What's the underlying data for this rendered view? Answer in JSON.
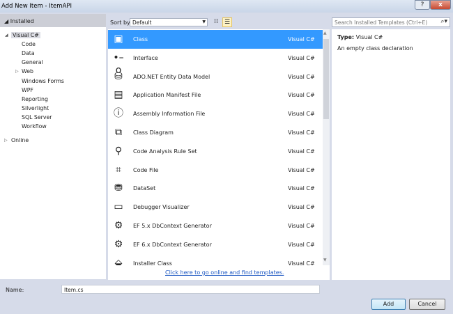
{
  "window": {
    "title": "Add New Item - ItemAPI",
    "help": "?",
    "close": "x"
  },
  "tree": {
    "header": "Installed",
    "items": [
      {
        "label": "Visual C#"
      },
      {
        "label": "Code"
      },
      {
        "label": "Data"
      },
      {
        "label": "General"
      },
      {
        "label": "Web"
      },
      {
        "label": "Windows Forms"
      },
      {
        "label": "WPF"
      },
      {
        "label": "Reporting"
      },
      {
        "label": "Silverlight"
      },
      {
        "label": "SQL Server"
      },
      {
        "label": "Workflow"
      }
    ],
    "online": "Online"
  },
  "toolbar": {
    "sort_label": "Sort by:",
    "sort_value": "Default"
  },
  "search": {
    "placeholder": "Search Installed Templates (Ctrl+E)"
  },
  "templates": [
    {
      "name": "Class",
      "lang": "Visual C#",
      "icon": "class-icon"
    },
    {
      "name": "Interface",
      "lang": "Visual C#",
      "icon": "interface-icon"
    },
    {
      "name": "ADO.NET Entity Data Model",
      "lang": "Visual C#",
      "icon": "entity-model-icon"
    },
    {
      "name": "Application Manifest File",
      "lang": "Visual C#",
      "icon": "manifest-icon"
    },
    {
      "name": "Assembly Information File",
      "lang": "Visual C#",
      "icon": "assembly-info-icon"
    },
    {
      "name": "Class Diagram",
      "lang": "Visual C#",
      "icon": "class-diagram-icon"
    },
    {
      "name": "Code Analysis Rule Set",
      "lang": "Visual C#",
      "icon": "rule-set-icon"
    },
    {
      "name": "Code File",
      "lang": "Visual C#",
      "icon": "code-file-icon"
    },
    {
      "name": "DataSet",
      "lang": "Visual C#",
      "icon": "dataset-icon"
    },
    {
      "name": "Debugger Visualizer",
      "lang": "Visual C#",
      "icon": "debugger-visualizer-icon"
    },
    {
      "name": "EF 5.x DbContext Generator",
      "lang": "Visual C#",
      "icon": "ef-generator-icon"
    },
    {
      "name": "EF 6.x DbContext Generator",
      "lang": "Visual C#",
      "icon": "ef-generator-icon"
    },
    {
      "name": "Installer Class",
      "lang": "Visual C#",
      "icon": "installer-icon"
    }
  ],
  "online_link": "Click here to go online and find templates.",
  "details": {
    "type_label": "Type:",
    "type_value": "Visual C#",
    "description": "An empty class declaration"
  },
  "form": {
    "name_label": "Name:",
    "name_value": "Item.cs",
    "add": "Add",
    "cancel": "Cancel"
  }
}
